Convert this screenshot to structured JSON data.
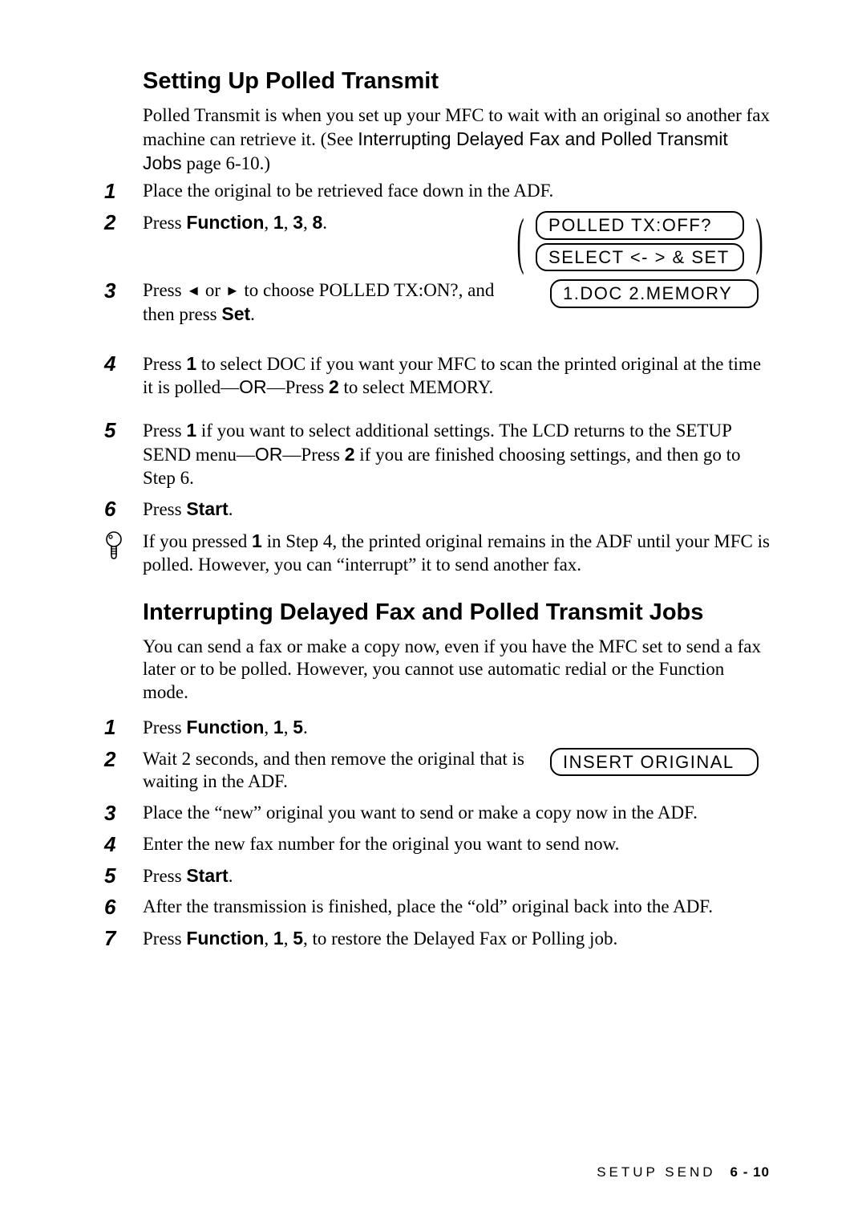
{
  "section1": {
    "title": "Setting Up Polled Transmit",
    "intro_a": "Polled Transmit is when you set up your MFC to wait with an original so another fax machine can retrieve it. (See ",
    "intro_link": "Interrupting Delayed Fax and Polled Transmit Jobs",
    "intro_b": " page 6-10.)",
    "steps": {
      "s1": "Place the original to be retrieved face down in the ADF.",
      "s2_a": "Press ",
      "s2_key": "Function",
      "s2_b": ", ",
      "s2_k1": "1",
      "s2_c": ", ",
      "s2_k2": "3",
      "s2_d": ", ",
      "s2_k3": "8",
      "s2_e": ".",
      "s3_a": "Press ",
      "s3_arrow_l": "◄",
      "s3_b": " or ",
      "s3_arrow_r": "►",
      "s3_c": " to choose POLLED TX:ON?, and then press ",
      "s3_key": "Set",
      "s3_d": ".",
      "s4_a": "Press ",
      "s4_k1": "1",
      "s4_b": " to select DOC if you want your MFC to scan the printed original at the time it is polled—",
      "s4_or": "OR",
      "s4_c": "—Press ",
      "s4_k2": "2",
      "s4_d": " to select MEMORY.",
      "s5_a": "Press ",
      "s5_k1": "1",
      "s5_b": " if you want to select additional settings. The LCD returns to the SETUP SEND menu—",
      "s5_or": "OR",
      "s5_c": "—Press ",
      "s5_k2": "2",
      "s5_d": " if you are finished choosing settings, and then go to Step 6.",
      "s6_a": "Press ",
      "s6_key": "Start",
      "s6_b": "."
    },
    "lcd": {
      "l1": "POLLED TX:OFF?",
      "l2": "SELECT <- > & SET",
      "l3": "1.DOC 2.MEMORY"
    },
    "note_a": "If you pressed ",
    "note_k1": "1",
    "note_b": " in Step 4, the printed original remains in the ADF until your MFC is polled.  However, you can “interrupt” it to send another fax."
  },
  "section2": {
    "title": "Interrupting Delayed Fax and Polled Transmit Jobs",
    "intro": "You can send a fax or make a copy now, even if you have the MFC set to send a fax later or to be polled. However, you cannot use automatic redial or the Function mode.",
    "steps": {
      "s1_a": "Press ",
      "s1_key": "Function",
      "s1_b": ", ",
      "s1_k1": "1",
      "s1_c": ", ",
      "s1_k2": "5",
      "s1_d": ".",
      "s2": "Wait 2 seconds, and then remove the original that is waiting in the ADF.",
      "s3": "Place the “new” original you want to send or make a copy now in the ADF.",
      "s4": "Enter the new fax number for the original you want to send now.",
      "s5_a": "Press ",
      "s5_key": "Start",
      "s5_b": ".",
      "s6": "After the transmission is finished, place the “old” original back into the ADF.",
      "s7_a": "Press ",
      "s7_key": "Function",
      "s7_b": ", ",
      "s7_k1": "1",
      "s7_c": ", ",
      "s7_k2": "5",
      "s7_d": ", to restore the Delayed Fax or Polling job."
    },
    "lcd": {
      "l1": "INSERT ORIGINAL"
    }
  },
  "footer": {
    "section": "SETUP SEND",
    "page": "6 - 10"
  }
}
